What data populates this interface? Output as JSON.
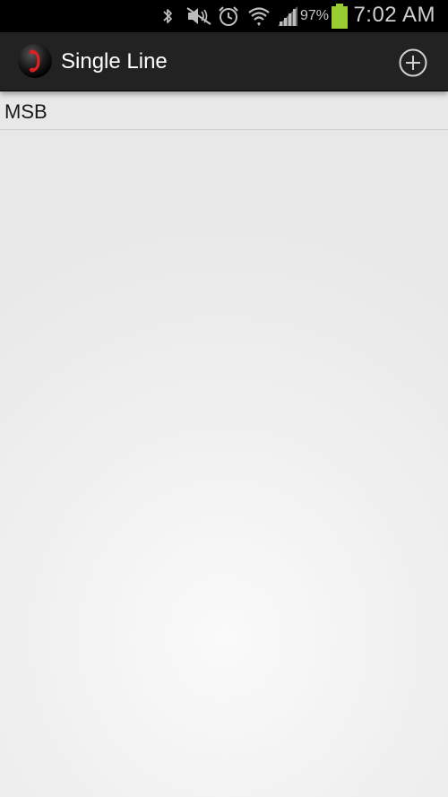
{
  "status_bar": {
    "battery_percent": "97%",
    "time": "7:02 AM",
    "icons": [
      "bluetooth-icon",
      "mute-icon",
      "alarm-icon",
      "wifi-icon",
      "signal-icon",
      "battery-icon"
    ],
    "battery_color": "#9acd32"
  },
  "action_bar": {
    "title": "Single Line",
    "app_icon": "phone-handset-icon",
    "add_icon": "add-circle-icon"
  },
  "list": {
    "items": [
      {
        "label": "MSB"
      }
    ]
  }
}
